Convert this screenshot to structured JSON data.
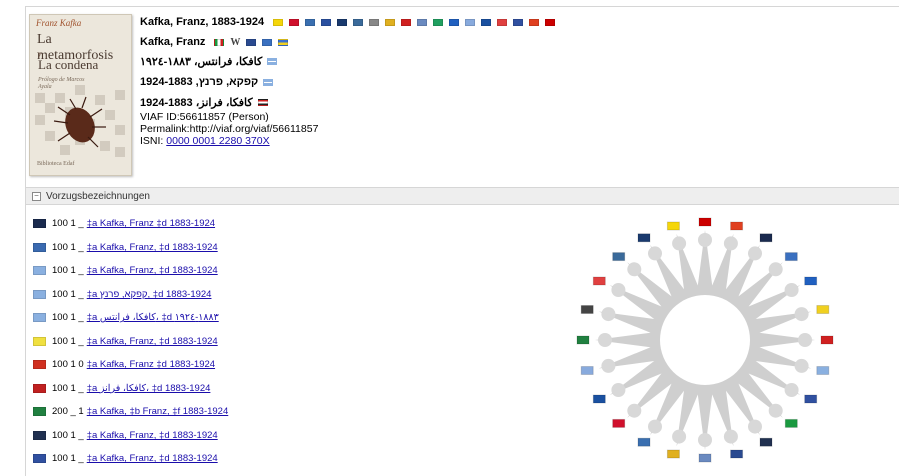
{
  "record": {
    "cover": {
      "author": "Franz Kafka",
      "title1": "La metamorfosis",
      "conjunction": "y",
      "title2": "La condena",
      "prologue": "Prólogo de Marcos Ayala",
      "publisher": "Biblioteca Edaf"
    },
    "heading": "Kafka, Franz, 1883-1924",
    "alt_names": [
      {
        "text": "Kafka, Franz",
        "bold": true
      },
      {
        "text": "كافكا، فرانتس، ١٨٨٣-١٩٢٤",
        "bold": true
      },
      {
        "text": "קפקא, פרנץ, 1924-1883",
        "bold": true
      },
      {
        "text": "كافكا، فرانز، 1883-1924",
        "bold": true
      }
    ],
    "viaf_id": "VIAF ID:56611857 (Person)",
    "permalink": "Permalink:http://viaf.org/viaf/56611857",
    "isni_label": "ISNI:",
    "isni_value": "0000 0001 2280 370X",
    "heading_flags": [
      "#f5d60a",
      "#d0102c",
      "#3a6fb0",
      "#2a50a0",
      "#1a3a6e",
      "#3a6a9a",
      "#888888",
      "#e0b020",
      "#d02020",
      "#6a8ac0",
      "#20a060",
      "#2060c0",
      "#88aadd",
      "#1a50a0",
      "#e04040",
      "#3050a0",
      "#e04020",
      "#cc0000"
    ]
  },
  "section": {
    "title": "Vorzugsbezeichnungen",
    "toggle": "−"
  },
  "rows": [
    {
      "flag": "#1a2a4e",
      "field": "100 1 _",
      "link": "‡a  Kafka, Franz ‡d  1883-1924"
    },
    {
      "flag": "#3a6ab0",
      "field": "100 1 _",
      "link": "‡a  Kafka, Franz, ‡d  1883-1924"
    },
    {
      "flag": "#8ab0e0",
      "field": "100 1 _",
      "link": "‡a  Kafka, Franz, ‡d  1883-1924"
    },
    {
      "flag": "#8ab0e0",
      "field": "100 1 _",
      "link": "‡a  קפקא, פרנץ, ‡d  1883-1924"
    },
    {
      "flag": "#8ab0e0",
      "field": "100 1 _",
      "link": "‡a  كافكا، فرانتس، ‡d  ١٨٨٣-١٩٢٤"
    },
    {
      "flag": "#f0e040",
      "field": "100 1 _",
      "link": "‡a  Kafka, Franz, ‡d  1883-1924"
    },
    {
      "flag": "#d03020",
      "field": "100 1 0",
      "link": "‡a  Kafka, Franz ‡d  1883-1924"
    },
    {
      "flag": "#c02020",
      "field": "100 1 _",
      "link": "‡a  كافكا، فرانز، ‡d  1883-1924"
    },
    {
      "flag": "#208040",
      "field": "200 _ 1",
      "link": "‡a  Kafka, ‡b  Franz, ‡f  1883-1924"
    },
    {
      "flag": "#203050",
      "field": "100 1 _",
      "link": "‡a  Kafka, Franz, ‡d  1883-1924"
    },
    {
      "flag": "#3050a0",
      "field": "100 1 _",
      "link": "‡a  Kafka, Franz, ‡d  1883-1924"
    }
  ]
}
